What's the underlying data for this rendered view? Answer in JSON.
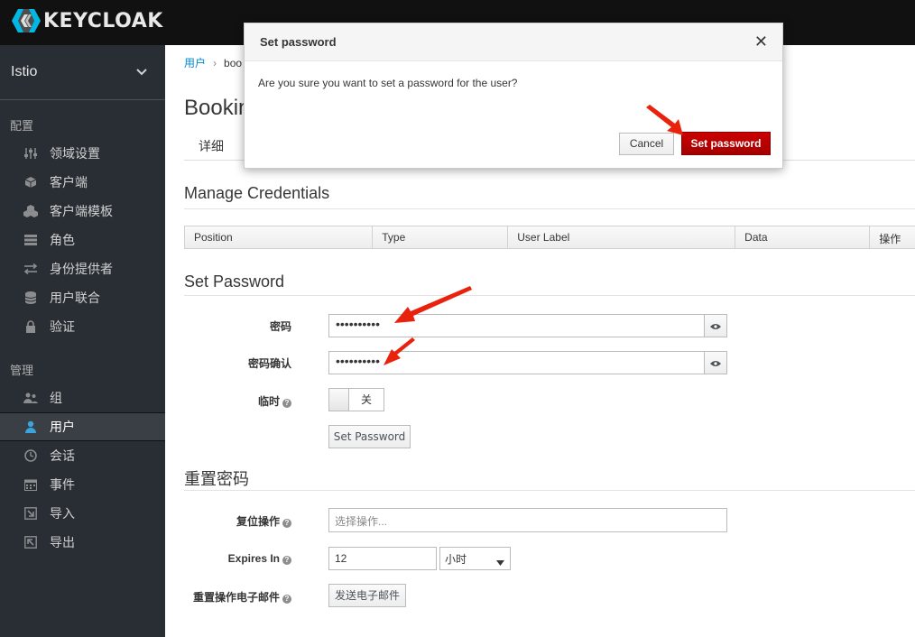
{
  "header": {
    "logo_text": "KEYCLOAK"
  },
  "sidebar": {
    "realm": "Istio",
    "section_config": "配置",
    "config_items": [
      {
        "label": "领域设置",
        "icon": "sliders-icon"
      },
      {
        "label": "客户端",
        "icon": "cube-icon"
      },
      {
        "label": "客户端模板",
        "icon": "cubes-icon"
      },
      {
        "label": "角色",
        "icon": "list-icon"
      },
      {
        "label": "身份提供者",
        "icon": "exchange-icon"
      },
      {
        "label": "用户联合",
        "icon": "database-icon"
      },
      {
        "label": "验证",
        "icon": "lock-icon"
      }
    ],
    "section_manage": "管理",
    "manage_items": [
      {
        "label": "组",
        "icon": "users-icon"
      },
      {
        "label": "用户",
        "icon": "user-icon",
        "active": true
      },
      {
        "label": "会话",
        "icon": "clock-icon"
      },
      {
        "label": "事件",
        "icon": "calendar-icon"
      },
      {
        "label": "导入",
        "icon": "import-icon"
      },
      {
        "label": "导出",
        "icon": "export-icon"
      }
    ]
  },
  "breadcrumb": {
    "parent": "用户",
    "current": "boo"
  },
  "page": {
    "title": "Bookin",
    "tab_details": "详细"
  },
  "credentials": {
    "heading": "Manage Credentials",
    "columns": [
      "Position",
      "Type",
      "User Label",
      "Data",
      "操作"
    ]
  },
  "set_password": {
    "heading": "Set Password",
    "password_label": "密码",
    "password_value": "••••••••••",
    "confirm_label": "密码确认",
    "confirm_value": "••••••••••",
    "temporary_label": "临时",
    "temporary_value": "关",
    "button": "Set Password"
  },
  "reset_password": {
    "heading": "重置密码",
    "actions_label": "复位操作",
    "actions_placeholder": "选择操作...",
    "expires_label": "Expires In",
    "expires_value": "12",
    "expires_unit": "小时",
    "email_label": "重置操作电子邮件",
    "email_button": "发送电子邮件"
  },
  "modal": {
    "title": "Set password",
    "message": "Are you sure you want to set a password for the user?",
    "cancel": "Cancel",
    "confirm": "Set password"
  },
  "colors": {
    "accent": "#cc0000",
    "link": "#0088ce",
    "sidebar_bg": "#292e34"
  }
}
